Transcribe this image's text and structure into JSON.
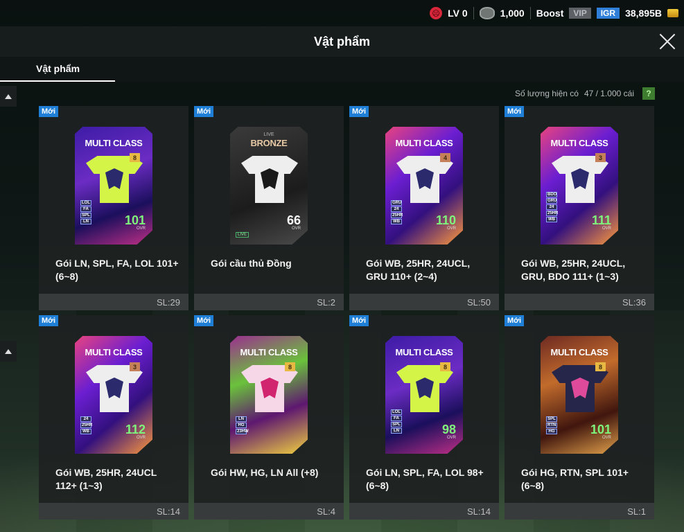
{
  "status": {
    "level_label": "LV 0",
    "coins": "1,000",
    "boost_label": "Boost",
    "vip_label": "VIP",
    "igr_label": "IGR",
    "bp": "38,895B"
  },
  "header": {
    "title": "Vật phẩm"
  },
  "tabs": [
    {
      "label": "Vật phẩm",
      "active": true
    }
  ],
  "inventory": {
    "label": "Số lượng hiện có",
    "count": "47 / 1.000 cái",
    "help": "?"
  },
  "items": [
    {
      "badge": "Mới",
      "card_title": "MULTI CLASS",
      "level": "8",
      "chips": [
        "LOL",
        "FA",
        "SPL",
        "LN"
      ],
      "ovr": "101",
      "ovr_label": "OVR",
      "name": "Gói LN, SPL, FA, LOL 101+ (6~8)",
      "qty": "SL:29"
    },
    {
      "badge": "Mới",
      "card_sub": "LIVE",
      "card_title": "BRONZE",
      "live_tag": "LIVE",
      "ovr": "66",
      "ovr_label": "OVR",
      "name": "Gói cầu thủ Đồng",
      "qty": "SL:2"
    },
    {
      "badge": "Mới",
      "card_title": "MULTI CLASS",
      "level": "4",
      "chips": [
        "GRU",
        "24",
        "25HR",
        "WB"
      ],
      "ovr": "110",
      "ovr_label": "OVR",
      "name": "Gói WB, 25HR, 24UCL, GRU 110+ (2~4)",
      "qty": "SL:50"
    },
    {
      "badge": "Mới",
      "card_title": "MULTI CLASS",
      "level": "3",
      "chips": [
        "BDO",
        "GRU",
        "24",
        "25HR",
        "WB"
      ],
      "ovr": "111",
      "ovr_label": "OVR",
      "name": "Gói WB, 25HR, 24UCL, GRU, BDO 111+ (1~3)",
      "qty": "SL:36"
    },
    {
      "badge": "Mới",
      "card_title": "MULTI CLASS",
      "level": "3",
      "chips": [
        "24",
        "25HR",
        "WB"
      ],
      "ovr": "112",
      "ovr_label": "OVR",
      "name": "Gói WB, 25HR, 24UCL 112+ (1~3)",
      "qty": "SL:14"
    },
    {
      "badge": "Mới",
      "card_title": "MULTI CLASS",
      "level": "8",
      "chips": [
        "LN",
        "HG",
        "23HW"
      ],
      "ovr": "",
      "ovr_label": "",
      "name": "Gói HW, HG, LN All (+8)",
      "qty": "SL:4"
    },
    {
      "badge": "Mới",
      "card_title": "MULTI CLASS",
      "level": "8",
      "chips": [
        "LOL",
        "FA",
        "SPL",
        "LN"
      ],
      "ovr": "98",
      "ovr_label": "OVR",
      "name": "Gói LN, SPL, FA, LOL 98+ (6~8)",
      "qty": "SL:14"
    },
    {
      "badge": "Mới",
      "card_title": "MULTI CLASS",
      "level": "8",
      "chips": [
        "SPL",
        "RTN",
        "HG"
      ],
      "ovr": "101",
      "ovr_label": "OVR",
      "name": "Gói HG, RTN, SPL 101+ (6~8)",
      "qty": "SL:1"
    }
  ]
}
